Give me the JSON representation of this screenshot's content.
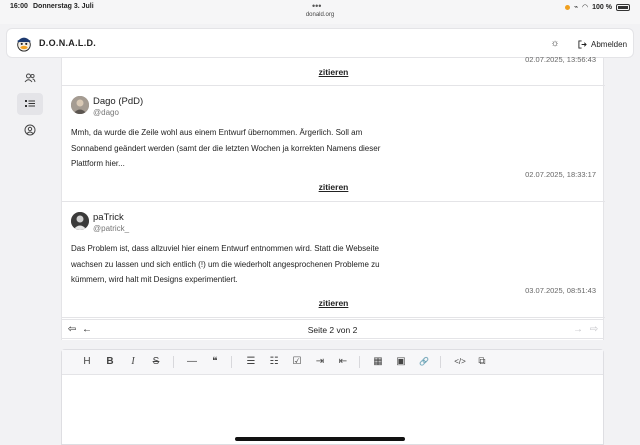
{
  "status_bar": {
    "time": "16:00",
    "date": "Donnerstag 3. Juli",
    "url": "donald.org",
    "battery": "100 %",
    "dots": "•••"
  },
  "header": {
    "brand": "D.O.N.A.L.D.",
    "theme_icon": "sun-icon",
    "logout_label": "Abmelden",
    "logout_icon": "logout-icon"
  },
  "sidebar": {
    "items": [
      {
        "icon": "users-icon",
        "active": false
      },
      {
        "icon": "list-icon",
        "active": true
      },
      {
        "icon": "user-circle-icon",
        "active": false
      }
    ]
  },
  "thread": {
    "top_partial": {
      "timestamp": "02.07.2025, 13:56:43",
      "cite_label": "zitieren"
    },
    "posts": [
      {
        "author": "Dago (PdD)",
        "handle": "@dago",
        "lines": [
          "Mmh, da wurde die Zeile wohl aus einem Entwurf übernommen. Ärgerlich. Soll am",
          "Sonnabend geändert werden (samt der die letzten Wochen ja korrekten Namens dieser",
          "Plattform hier..."
        ],
        "timestamp": "02.07.2025, 18:33:17",
        "cite_label": "zitieren"
      },
      {
        "author": "paTrick",
        "handle": "@patrick_",
        "lines": [
          "Das Problem ist, dass allzuviel hier einem Entwurf entnommen wird. Statt die Webseite",
          "wachsen zu lassen und sich entlich (!) um die wiederholt angesprochenen Probleme zu",
          "kümmern, wird halt mit Designs experimentiert."
        ],
        "timestamp": "03.07.2025, 08:51:43",
        "cite_label": "zitieren"
      }
    ]
  },
  "pagination": {
    "label": "Seite 2 von 2",
    "first_icon": "first-page-icon",
    "prev_icon": "prev-page-icon",
    "next_icon": "next-page-icon",
    "last_icon": "last-page-icon"
  },
  "editor": {
    "toolbar": [
      {
        "name": "heading-button",
        "glyph": "H"
      },
      {
        "name": "bold-button",
        "glyph": "B"
      },
      {
        "name": "italic-button",
        "glyph": "I"
      },
      {
        "name": "strike-button",
        "glyph": "S"
      },
      {
        "name": "hr-button",
        "glyph": "—"
      },
      {
        "name": "quote-button",
        "glyph": "❝"
      },
      {
        "name": "bullet-list-button",
        "glyph": "☰"
      },
      {
        "name": "ordered-list-button",
        "glyph": "☷"
      },
      {
        "name": "task-list-button",
        "glyph": "☑"
      },
      {
        "name": "indent-button",
        "glyph": "⇥"
      },
      {
        "name": "outdent-button",
        "glyph": "⇤"
      },
      {
        "name": "table-button",
        "glyph": "▦"
      },
      {
        "name": "image-button",
        "glyph": "▣"
      },
      {
        "name": "link-button",
        "glyph": "🔗"
      },
      {
        "name": "code-button",
        "glyph": "</>"
      },
      {
        "name": "code-block-button",
        "glyph": "⧉"
      }
    ]
  }
}
